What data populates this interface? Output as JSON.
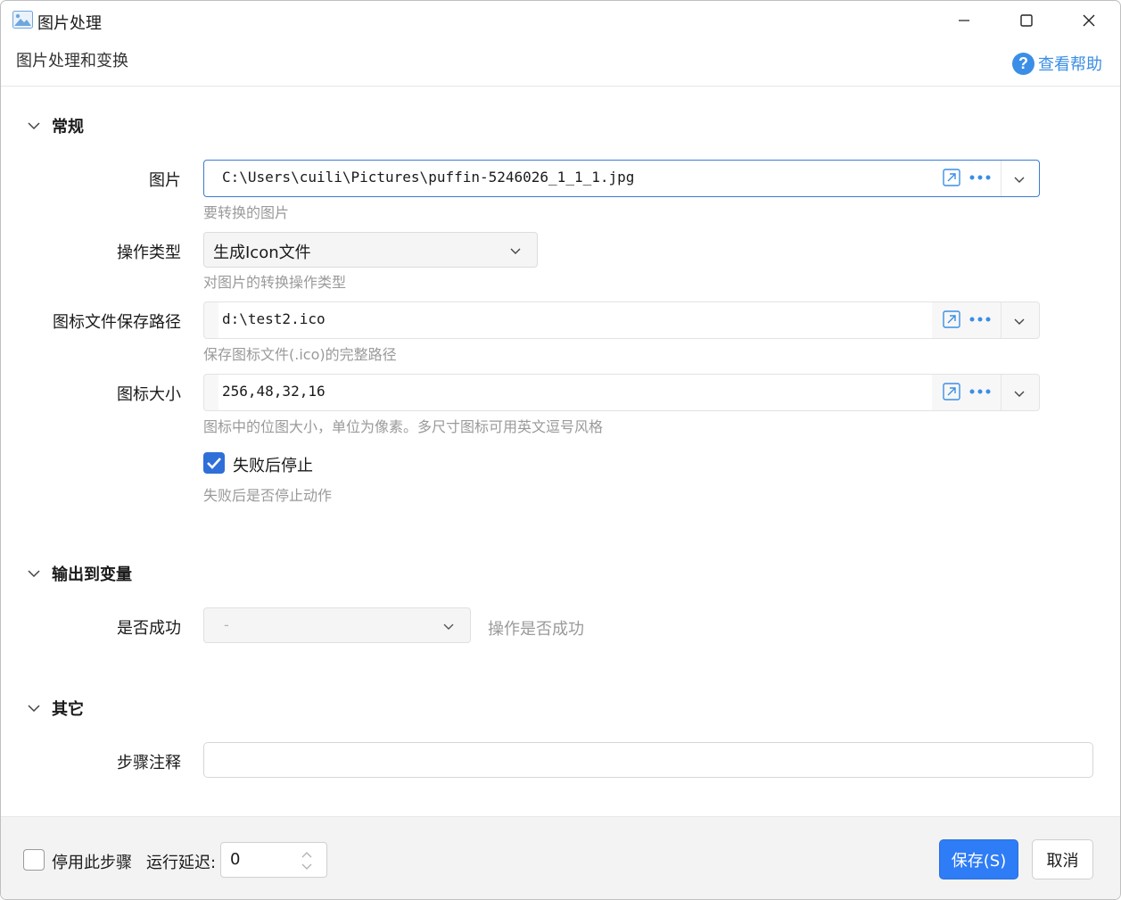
{
  "window": {
    "title": "图片处理",
    "subtitle": "图片处理和变换",
    "help_label": "查看帮助"
  },
  "sections": {
    "general": "常规",
    "output": "输出到变量",
    "other": "其它"
  },
  "form": {
    "image": {
      "label": "图片",
      "value": "C:\\Users\\cuili\\Pictures\\puffin-5246026_1_1_1.jpg",
      "hint": "要转换的图片"
    },
    "operation_type": {
      "label": "操作类型",
      "value": "生成Icon文件",
      "hint": "对图片的转换操作类型"
    },
    "icon_save_path": {
      "label": "图标文件保存路径",
      "value": "d:\\test2.ico",
      "hint": "保存图标文件(.ico)的完整路径"
    },
    "icon_size": {
      "label": "图标大小",
      "value": "256,48,32,16",
      "hint": "图标中的位图大小，单位为像素。多尺寸图标可用英文逗号风格"
    },
    "stop_on_fail": {
      "label": "失败后停止",
      "checked": true,
      "hint": "失败后是否停止动作"
    },
    "success_var": {
      "label": "是否成功",
      "value": "-",
      "hint": "操作是否成功"
    },
    "step_note": {
      "label": "步骤注释",
      "value": ""
    }
  },
  "footer": {
    "disable_step_label": "停用此步骤",
    "disable_step_checked": false,
    "delay_label": "运行延迟:",
    "delay_value": "0",
    "save_label": "保存(S)",
    "cancel_label": "取消"
  },
  "colors": {
    "accent": "#2e7cf6",
    "help": "#3a8ee6",
    "hint_text": "#9a9a9a"
  }
}
